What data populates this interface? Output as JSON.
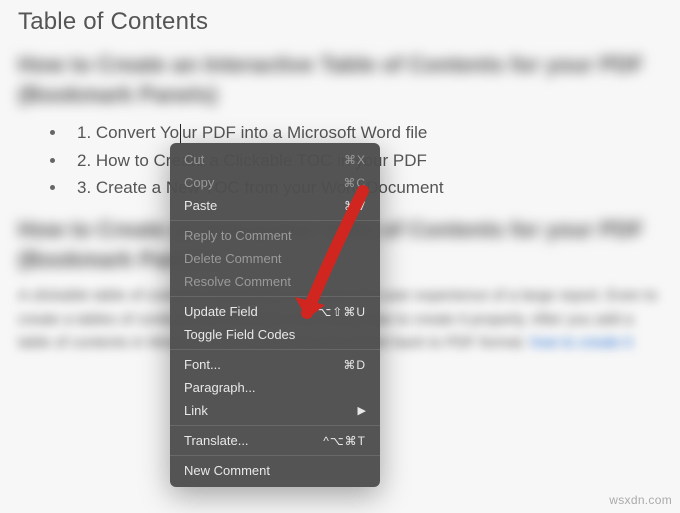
{
  "toc_title": "Table of Contents",
  "blur_heading1": "How to Create an Interactive Table of Contents for your PDF (Bookmark Panels)",
  "toc_items": [
    "1. Convert Your PDF into a Microsoft Word file",
    "2. How to Create a Clickable TOC in your PDF",
    "3. Create a New TOC from your Word Document"
  ],
  "caret_prefix": "1. Convert Yo",
  "caret_suffix": "ur PDF into a Microsoft Word file",
  "blur_heading2": "How to Create an Interactive Table of Contents for your PDF (Bookmark Panels)",
  "blur_para": "A clickable table of contents dramatically improves the user experience of a large report. Even to create a tables of contents with clickable links using how to create it properly. After you add a table of contents in Word you can convert the document back to PDF format.",
  "context_menu": {
    "groups": [
      [
        {
          "label": "Cut",
          "shortcut": "⌘X",
          "enabled": false
        },
        {
          "label": "Copy",
          "shortcut": "⌘C",
          "enabled": false
        },
        {
          "label": "Paste",
          "shortcut": "⌘V",
          "enabled": true
        }
      ],
      [
        {
          "label": "Reply to Comment",
          "shortcut": "",
          "enabled": false
        },
        {
          "label": "Delete Comment",
          "shortcut": "",
          "enabled": false
        },
        {
          "label": "Resolve Comment",
          "shortcut": "",
          "enabled": false
        }
      ],
      [
        {
          "label": "Update Field",
          "shortcut": "⌥⇧⌘U",
          "enabled": true
        },
        {
          "label": "Toggle Field Codes",
          "shortcut": "",
          "enabled": true
        }
      ],
      [
        {
          "label": "Font...",
          "shortcut": "⌘D",
          "enabled": true
        },
        {
          "label": "Paragraph...",
          "shortcut": "",
          "enabled": true
        },
        {
          "label": "Link",
          "shortcut": "",
          "enabled": true,
          "submenu": true
        }
      ],
      [
        {
          "label": "Translate...",
          "shortcut": "^⌥⌘T",
          "enabled": true
        }
      ],
      [
        {
          "label": "New Comment",
          "shortcut": "",
          "enabled": true
        }
      ]
    ]
  },
  "watermark": "wsxdn.com"
}
